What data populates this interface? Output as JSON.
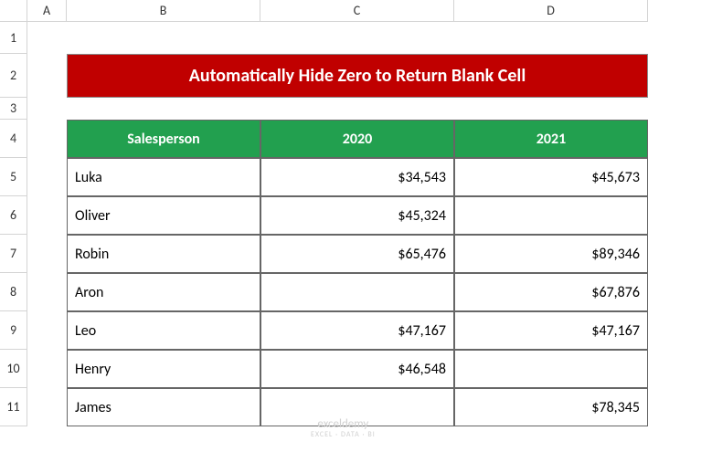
{
  "columns": [
    "A",
    "B",
    "C",
    "D"
  ],
  "rows": [
    "1",
    "2",
    "3",
    "4",
    "5",
    "6",
    "7",
    "8",
    "9",
    "10",
    "11"
  ],
  "title": "Automatically Hide Zero to Return Blank Cell",
  "headers": {
    "salesperson": "Salesperson",
    "y2020": "2020",
    "y2021": "2021"
  },
  "data": [
    {
      "name": "Luka",
      "y2020": "$34,543",
      "y2021": "$45,673"
    },
    {
      "name": "Oliver",
      "y2020": "$45,324",
      "y2021": ""
    },
    {
      "name": "Robin",
      "y2020": "$65,476",
      "y2021": "$89,346"
    },
    {
      "name": "Aron",
      "y2020": "",
      "y2021": "$67,876"
    },
    {
      "name": "Leo",
      "y2020": "$47,167",
      "y2021": "$47,167"
    },
    {
      "name": "Henry",
      "y2020": "$46,548",
      "y2021": ""
    },
    {
      "name": "James",
      "y2020": "",
      "y2021": "$78,345"
    }
  ],
  "watermark": {
    "main": "exceldemy",
    "sub": "EXCEL · DATA · BI"
  }
}
